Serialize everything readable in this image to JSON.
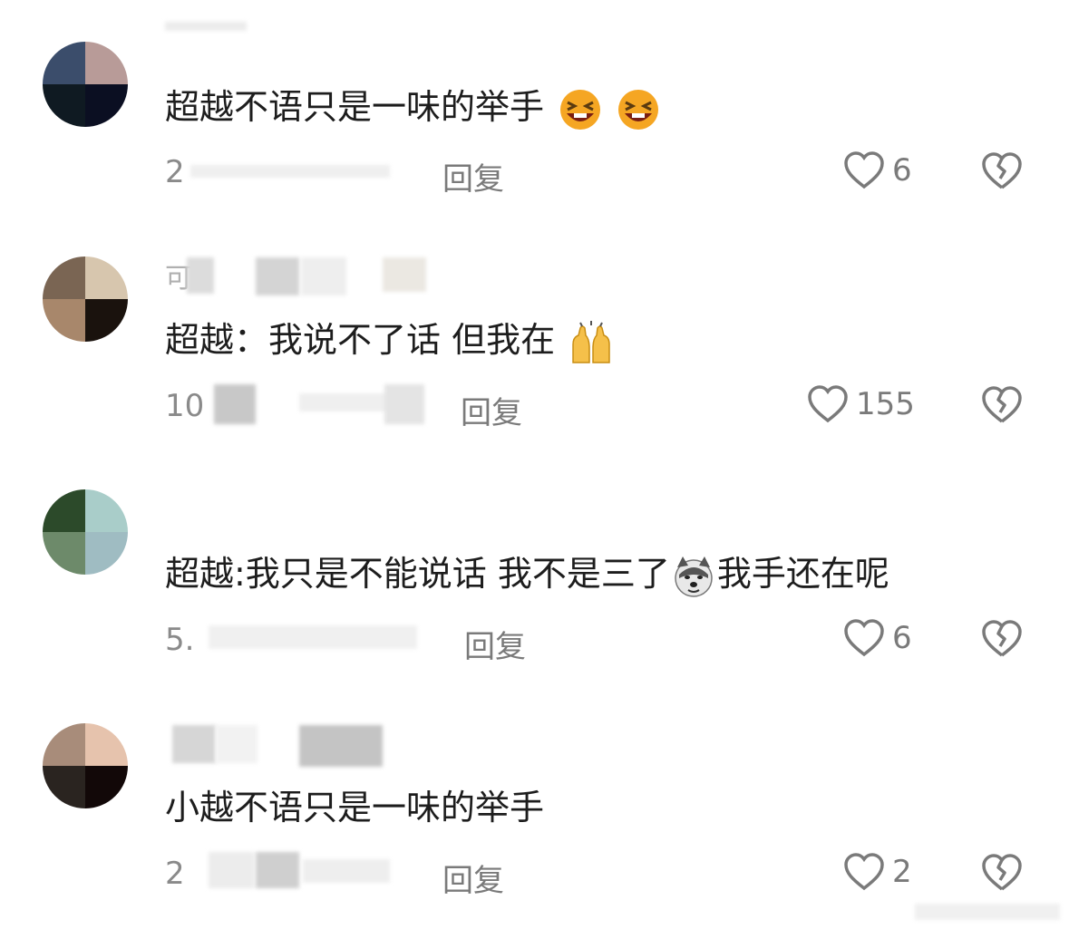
{
  "comments": [
    {
      "text": "超越不语只是一味的举手",
      "emojis": [
        "laughing-face-emoji",
        "laughing-face-emoji"
      ],
      "meta": "2",
      "reply_label": "回复",
      "likes": "6",
      "avatar_colors": [
        "#3b4d6b",
        "#b89b98",
        "#0f1a22",
        "#0b0f22"
      ]
    },
    {
      "username": "可",
      "text": "超越：我说不了话 但我在",
      "emojis": [
        "raising-hands-emoji"
      ],
      "meta": "10",
      "reply_label": "回复",
      "likes": "155",
      "avatar_colors": [
        "#7a6553",
        "#d7c6ae",
        "#a8876b",
        "#1a120d"
      ]
    },
    {
      "text": "超越:我只是不能说话 我不是三了",
      "text_after": "我手还在呢",
      "emojis": [
        "husky-dog-emoji"
      ],
      "meta": "5.",
      "reply_label": "回复",
      "likes": "6",
      "avatar_colors": [
        "#2c4a2a",
        "#a9cdc9",
        "#6d8a6a",
        "#9fbcc2"
      ]
    },
    {
      "text": "小越不语只是一味的举手",
      "meta": "2",
      "reply_label": "回复",
      "likes": "2",
      "avatar_colors": [
        "#a88c7a",
        "#e6c3ad",
        "#2a2420",
        "#120808"
      ]
    }
  ],
  "colors": {
    "text": "#1d1d1d",
    "meta": "#8a8a8a",
    "icon": "#7a7a7a"
  }
}
